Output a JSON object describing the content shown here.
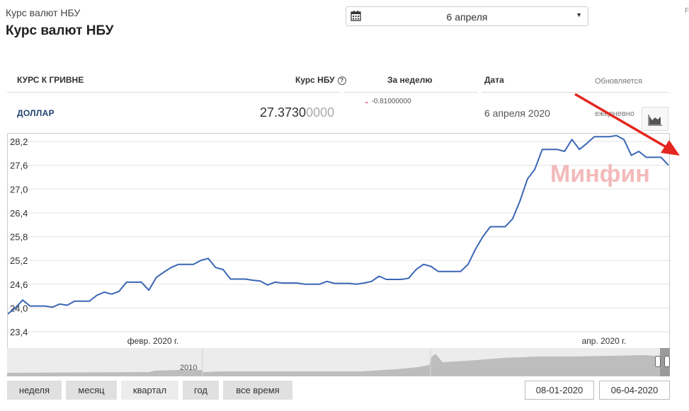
{
  "breadcrumb": "Курс валют НБУ",
  "page_title": "Курс валют НБУ",
  "date_picker": {
    "value": "6 апреля"
  },
  "edge_text": "F",
  "table": {
    "headers": {
      "currency": "КУРС К ГРИВНЕ",
      "rate": "Курс НБУ",
      "week": "За неделю",
      "date": "Дата",
      "updated": "Обновляется"
    },
    "row": {
      "currency": "ДОЛЛАР",
      "rate_main": "27.3730",
      "rate_tail": "0000",
      "week_change": "-0.81000000",
      "date": "6 апреля 2020",
      "updated": "ежедневно"
    }
  },
  "watermark": "Минфин",
  "colors": {
    "line": "#3a66b5",
    "accent_red": "#e3261f",
    "header_blue": "#1f3f6e"
  },
  "chart_data": {
    "type": "line",
    "title": "",
    "x_tick_labels": [
      "февр. 2020 г.",
      "апр. 2020 г."
    ],
    "y_ticks": [
      "28,2",
      "27,6",
      "27,0",
      "26,4",
      "25,8",
      "25,2",
      "24,6",
      "24,0",
      "23,4"
    ],
    "ylim": [
      23.4,
      28.2
    ],
    "grid": true,
    "series": [
      {
        "values": [
          23.85,
          24.0,
          24.2,
          24.05,
          24.05,
          24.05,
          24.02,
          24.1,
          24.07,
          24.17,
          24.17,
          24.17,
          24.32,
          24.4,
          24.35,
          24.42,
          24.65,
          24.65,
          24.65,
          24.45,
          24.77,
          24.9,
          25.02,
          25.1,
          25.1,
          25.1,
          25.2,
          25.25,
          25.02,
          24.97,
          24.73,
          24.73,
          24.73,
          24.7,
          24.68,
          24.58,
          24.65,
          24.63,
          24.63,
          24.63,
          24.6,
          24.6,
          24.6,
          24.67,
          24.62,
          24.62,
          24.62,
          24.6,
          24.63,
          24.67,
          24.8,
          24.72,
          24.72,
          24.72,
          24.75,
          24.97,
          25.1,
          25.05,
          24.92,
          24.92,
          24.92,
          24.92,
          25.1,
          25.48,
          25.8,
          26.05,
          26.05,
          26.05,
          26.25,
          26.7,
          27.25,
          27.5,
          28.0,
          28.0,
          28.0,
          27.95,
          28.25,
          28.0,
          28.15,
          28.32,
          28.32,
          28.32,
          28.35,
          28.25,
          27.85,
          27.95,
          27.8,
          27.8,
          27.8,
          27.6
        ]
      }
    ]
  },
  "navigator": {
    "label": "2010"
  },
  "range_buttons": [
    "неделя",
    "месяц",
    "квартал",
    "год",
    "все время"
  ],
  "active_range": "квартал",
  "date_from": "08-01-2020",
  "date_to": "06-04-2020"
}
